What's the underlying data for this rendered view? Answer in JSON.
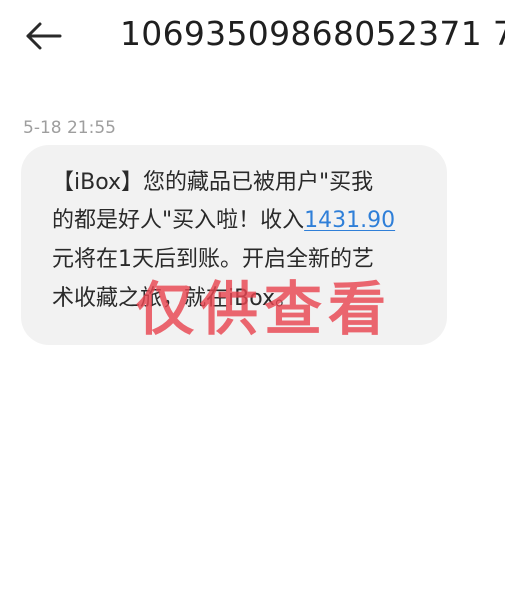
{
  "header": {
    "back_icon": "arrow-left-icon",
    "sender_number": "10693509868052371 7"
  },
  "conversation": {
    "timestamp": "5-18 21:55",
    "message": {
      "line1": "【iBox】您的藏品已被用户\"买我",
      "line2_before": "的都是好人\"买入啦！收入",
      "amount": "1431.90",
      "line3": "元将在1天后到账。开启全新的艺",
      "line4": "术收藏之旅，就在iBox。"
    }
  },
  "watermark": {
    "text": "仅供查看"
  },
  "colors": {
    "link": "#2f7fd8",
    "bubble": "#f2f2f2",
    "watermark": "#e84650"
  }
}
